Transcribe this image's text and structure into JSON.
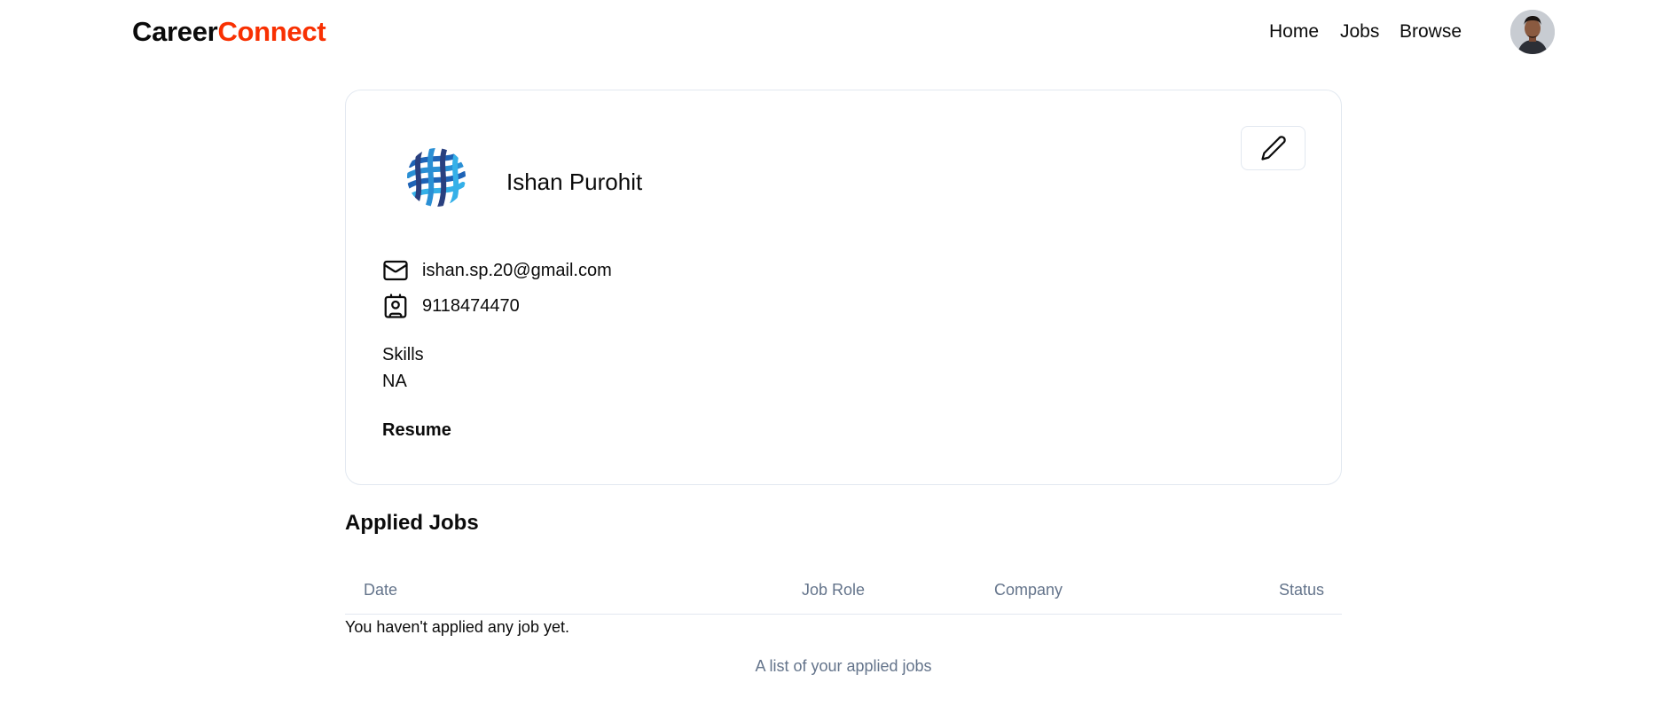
{
  "navbar": {
    "logo_part1": "Career",
    "logo_part2": "Connect",
    "links": [
      {
        "label": "Home"
      },
      {
        "label": "Jobs"
      },
      {
        "label": "Browse"
      }
    ],
    "avatar_icon": "user-avatar"
  },
  "profile": {
    "logo_icon": "company-logo-icon",
    "name": "Ishan Purohit",
    "edit_icon": "pencil-icon",
    "email_icon": "mail-icon",
    "email": "ishan.sp.20@gmail.com",
    "phone_icon": "contact-icon",
    "phone": "9118474470",
    "skills_label": "Skills",
    "skills_value": "NA",
    "resume_label": "Resume"
  },
  "applied_jobs": {
    "title": "Applied Jobs",
    "columns": [
      "Date",
      "Job Role",
      "Company",
      "Status"
    ],
    "empty_message": "You haven't applied any job yet.",
    "caption": "A list of your applied jobs"
  },
  "colors": {
    "brand_accent": "#f83002",
    "muted_text": "#64748b",
    "border": "#e2e8f0"
  }
}
